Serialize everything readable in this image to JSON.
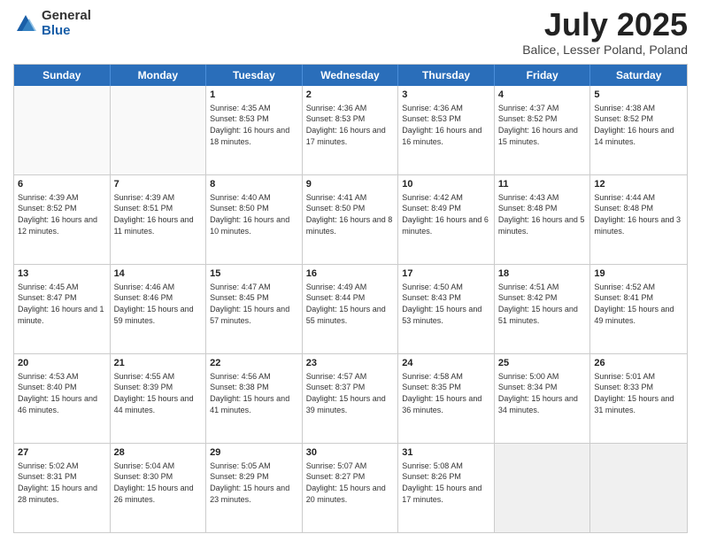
{
  "logo": {
    "general": "General",
    "blue": "Blue"
  },
  "title": "July 2025",
  "location": "Balice, Lesser Poland, Poland",
  "weekdays": [
    "Sunday",
    "Monday",
    "Tuesday",
    "Wednesday",
    "Thursday",
    "Friday",
    "Saturday"
  ],
  "weeks": [
    [
      {
        "day": "",
        "info": ""
      },
      {
        "day": "",
        "info": ""
      },
      {
        "day": "1",
        "info": "Sunrise: 4:35 AM\nSunset: 8:53 PM\nDaylight: 16 hours and 18 minutes."
      },
      {
        "day": "2",
        "info": "Sunrise: 4:36 AM\nSunset: 8:53 PM\nDaylight: 16 hours and 17 minutes."
      },
      {
        "day": "3",
        "info": "Sunrise: 4:36 AM\nSunset: 8:53 PM\nDaylight: 16 hours and 16 minutes."
      },
      {
        "day": "4",
        "info": "Sunrise: 4:37 AM\nSunset: 8:52 PM\nDaylight: 16 hours and 15 minutes."
      },
      {
        "day": "5",
        "info": "Sunrise: 4:38 AM\nSunset: 8:52 PM\nDaylight: 16 hours and 14 minutes."
      }
    ],
    [
      {
        "day": "6",
        "info": "Sunrise: 4:39 AM\nSunset: 8:52 PM\nDaylight: 16 hours and 12 minutes."
      },
      {
        "day": "7",
        "info": "Sunrise: 4:39 AM\nSunset: 8:51 PM\nDaylight: 16 hours and 11 minutes."
      },
      {
        "day": "8",
        "info": "Sunrise: 4:40 AM\nSunset: 8:50 PM\nDaylight: 16 hours and 10 minutes."
      },
      {
        "day": "9",
        "info": "Sunrise: 4:41 AM\nSunset: 8:50 PM\nDaylight: 16 hours and 8 minutes."
      },
      {
        "day": "10",
        "info": "Sunrise: 4:42 AM\nSunset: 8:49 PM\nDaylight: 16 hours and 6 minutes."
      },
      {
        "day": "11",
        "info": "Sunrise: 4:43 AM\nSunset: 8:48 PM\nDaylight: 16 hours and 5 minutes."
      },
      {
        "day": "12",
        "info": "Sunrise: 4:44 AM\nSunset: 8:48 PM\nDaylight: 16 hours and 3 minutes."
      }
    ],
    [
      {
        "day": "13",
        "info": "Sunrise: 4:45 AM\nSunset: 8:47 PM\nDaylight: 16 hours and 1 minute."
      },
      {
        "day": "14",
        "info": "Sunrise: 4:46 AM\nSunset: 8:46 PM\nDaylight: 15 hours and 59 minutes."
      },
      {
        "day": "15",
        "info": "Sunrise: 4:47 AM\nSunset: 8:45 PM\nDaylight: 15 hours and 57 minutes."
      },
      {
        "day": "16",
        "info": "Sunrise: 4:49 AM\nSunset: 8:44 PM\nDaylight: 15 hours and 55 minutes."
      },
      {
        "day": "17",
        "info": "Sunrise: 4:50 AM\nSunset: 8:43 PM\nDaylight: 15 hours and 53 minutes."
      },
      {
        "day": "18",
        "info": "Sunrise: 4:51 AM\nSunset: 8:42 PM\nDaylight: 15 hours and 51 minutes."
      },
      {
        "day": "19",
        "info": "Sunrise: 4:52 AM\nSunset: 8:41 PM\nDaylight: 15 hours and 49 minutes."
      }
    ],
    [
      {
        "day": "20",
        "info": "Sunrise: 4:53 AM\nSunset: 8:40 PM\nDaylight: 15 hours and 46 minutes."
      },
      {
        "day": "21",
        "info": "Sunrise: 4:55 AM\nSunset: 8:39 PM\nDaylight: 15 hours and 44 minutes."
      },
      {
        "day": "22",
        "info": "Sunrise: 4:56 AM\nSunset: 8:38 PM\nDaylight: 15 hours and 41 minutes."
      },
      {
        "day": "23",
        "info": "Sunrise: 4:57 AM\nSunset: 8:37 PM\nDaylight: 15 hours and 39 minutes."
      },
      {
        "day": "24",
        "info": "Sunrise: 4:58 AM\nSunset: 8:35 PM\nDaylight: 15 hours and 36 minutes."
      },
      {
        "day": "25",
        "info": "Sunrise: 5:00 AM\nSunset: 8:34 PM\nDaylight: 15 hours and 34 minutes."
      },
      {
        "day": "26",
        "info": "Sunrise: 5:01 AM\nSunset: 8:33 PM\nDaylight: 15 hours and 31 minutes."
      }
    ],
    [
      {
        "day": "27",
        "info": "Sunrise: 5:02 AM\nSunset: 8:31 PM\nDaylight: 15 hours and 28 minutes."
      },
      {
        "day": "28",
        "info": "Sunrise: 5:04 AM\nSunset: 8:30 PM\nDaylight: 15 hours and 26 minutes."
      },
      {
        "day": "29",
        "info": "Sunrise: 5:05 AM\nSunset: 8:29 PM\nDaylight: 15 hours and 23 minutes."
      },
      {
        "day": "30",
        "info": "Sunrise: 5:07 AM\nSunset: 8:27 PM\nDaylight: 15 hours and 20 minutes."
      },
      {
        "day": "31",
        "info": "Sunrise: 5:08 AM\nSunset: 8:26 PM\nDaylight: 15 hours and 17 minutes."
      },
      {
        "day": "",
        "info": ""
      },
      {
        "day": "",
        "info": ""
      }
    ]
  ]
}
